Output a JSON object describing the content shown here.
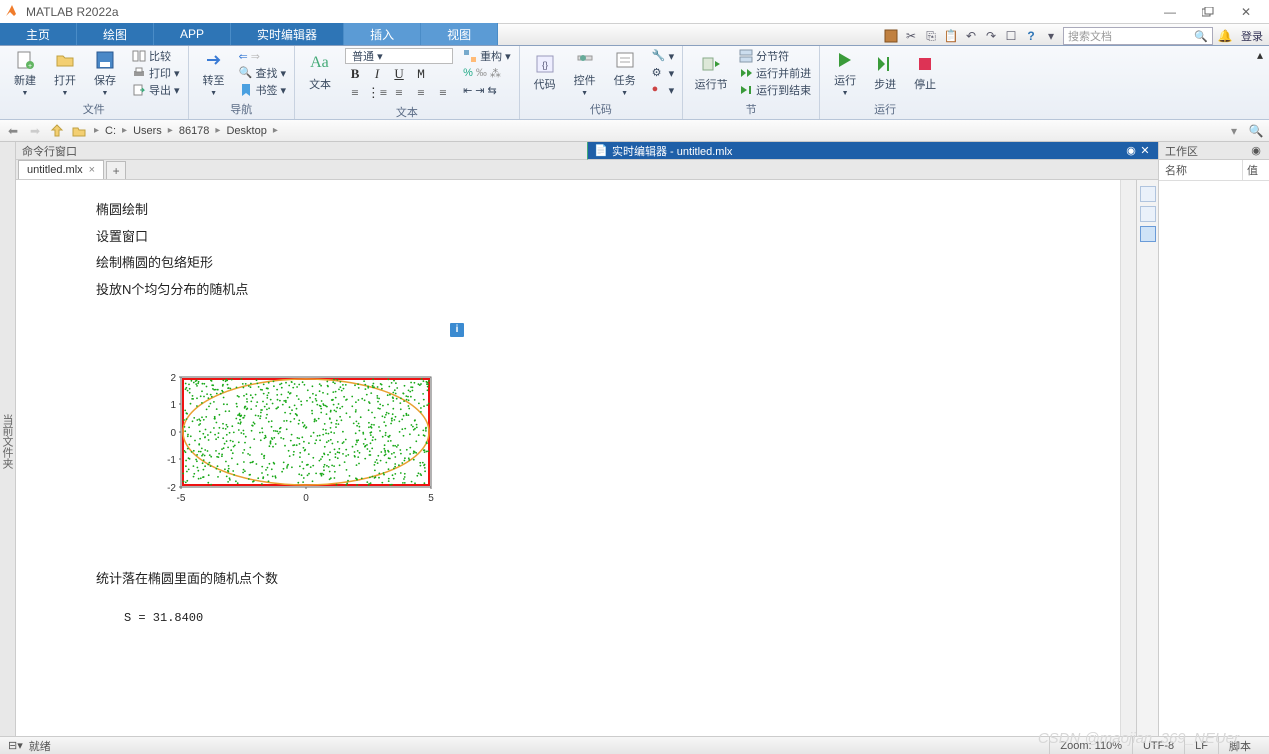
{
  "app": {
    "title": "MATLAB R2022a"
  },
  "tabs": {
    "home": "主页",
    "plots": "绘图",
    "apps": "APP",
    "liveeditor": "实时编辑器",
    "insert": "插入",
    "view": "视图",
    "login": "登录",
    "search_ph": "搜索文档"
  },
  "toolstrip": {
    "file": {
      "label": "文件",
      "new": "新建",
      "open": "打开",
      "save": "保存",
      "compare": "比较",
      "print": "打印",
      "export": "导出"
    },
    "nav": {
      "label": "导航",
      "goto": "转至",
      "find": "查找",
      "bookmark": "书签"
    },
    "text": {
      "label": "文本",
      "text": "文本",
      "normal": "普通",
      "refactor": "重构"
    },
    "code": {
      "label": "代码",
      "code": "代码",
      "control": "控件",
      "task": "任务"
    },
    "section": {
      "label": "节",
      "runsection": "运行节",
      "split": "分节符",
      "runadvance": "运行并前进",
      "runtoend": "运行到结束"
    },
    "run": {
      "label": "运行",
      "run": "运行",
      "step": "步进",
      "stop": "停止"
    }
  },
  "address": {
    "drive": "C:",
    "p1": "Users",
    "p2": "86178",
    "p3": "Desktop"
  },
  "cmdwin": "命令行窗口",
  "leftlabel": "当前文件夹",
  "editorpane": {
    "title": "实时编辑器 - untitled.mlx"
  },
  "filetab": {
    "name": "untitled.mlx"
  },
  "doc": {
    "l1": "椭圆绘制",
    "l2": "设置窗口",
    "l3": "绘制椭圆的包络矩形",
    "l4": "投放N个均匀分布的随机点",
    "l5": "统计落在椭圆里面的随机点个数",
    "result": "S = 31.8400"
  },
  "chart_data": {
    "type": "scatter",
    "title": "",
    "xlabel": "",
    "ylabel": "",
    "xlim": [
      -5,
      5
    ],
    "ylim": [
      -2,
      2
    ],
    "xticks": [
      -5,
      0,
      5
    ],
    "yticks": [
      -2,
      -1,
      0,
      1,
      2
    ],
    "shapes": [
      {
        "kind": "rect",
        "x0": -5,
        "y0": -2,
        "x1": 5,
        "y1": 2,
        "color": "#e11",
        "lw": 2
      },
      {
        "kind": "ellipse",
        "cx": 0,
        "cy": 0,
        "rx": 5,
        "ry": 2,
        "color": "#e9a030",
        "lw": 1.5
      }
    ],
    "series": [
      {
        "name": "random points",
        "marker": ".",
        "color": "#18a818",
        "note": "≈1000 uniformly distributed points in rectangle [-5,5]×[-2,2]"
      }
    ]
  },
  "workspace": {
    "title": "工作区",
    "col1": "名称",
    "col2": "值"
  },
  "status": {
    "ready": "就绪",
    "zoom": "Zoom: 110%",
    "enc": "UTF-8",
    "le": "LF",
    "mode": "脚本"
  },
  "watermark": "CSDN @maojian_369_NEUer"
}
